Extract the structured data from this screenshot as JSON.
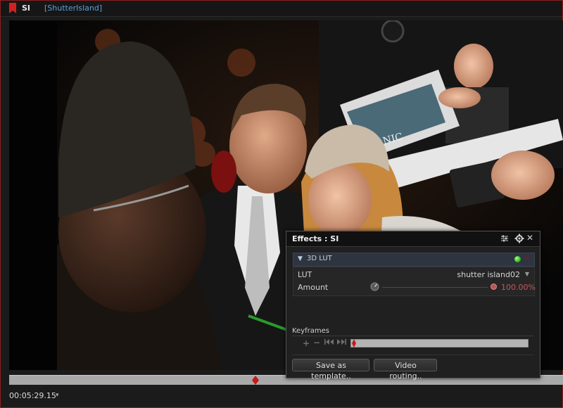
{
  "top_bar": {
    "clip_name": "SI",
    "clip_file": "[ShutterIsland]",
    "bookmark_icon": "bookmark-icon",
    "bookmark_color": "#d42020"
  },
  "viewer": {
    "content": "photo-frame"
  },
  "timeline": {
    "timecode": "00:05:29.15",
    "timecode_arrow": "▾",
    "playhead_color": "#c41a1a",
    "playhead_position": 0.445
  },
  "effects_panel": {
    "title": "Effects : SI",
    "icons": [
      "sliders-icon",
      "gear-icon",
      "close-icon"
    ],
    "close_glyph": "✕",
    "effect": {
      "expand_glyph": "▼",
      "name": "3D LUT",
      "enabled_color": "#2fbf1f",
      "remove_glyph": "✕",
      "params": {
        "lut_label": "LUT",
        "lut_value": "shutter island02",
        "lut_dropdown_glyph": "▼",
        "amount_label": "Amount",
        "amount_value": "100.00%"
      }
    },
    "keyframes": {
      "label": "Keyframes",
      "add_glyph": "+",
      "remove_glyph": "−",
      "prev_glyph": "I◀◀",
      "next_glyph": "▶▶I"
    },
    "buttons": {
      "save_template": "Save as template..",
      "video_routing": "Video routing.."
    }
  }
}
